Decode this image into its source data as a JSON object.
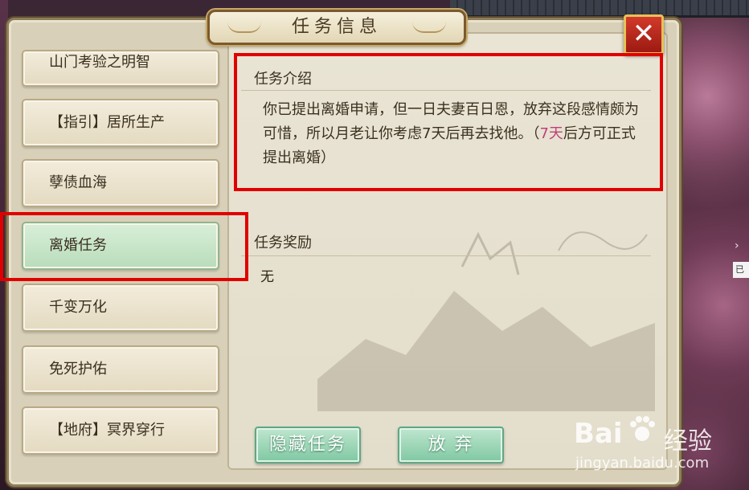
{
  "title": "任务信息",
  "close_label": "✕",
  "quests": [
    {
      "label": "山门考验之明智",
      "selected": false
    },
    {
      "label": "【指引】居所生产",
      "selected": false
    },
    {
      "label": "孽债血海",
      "selected": false
    },
    {
      "label": "离婚任务",
      "selected": true
    },
    {
      "label": "千变万化",
      "selected": false
    },
    {
      "label": "免死护佑",
      "selected": false
    },
    {
      "label": "【地府】冥界穿行",
      "selected": false
    }
  ],
  "intro": {
    "label": "任务介绍",
    "text_main": "你已提出离婚申请，但一日夫妻百日恩，放弃这段感情颇为可惜，所以月老让你考虑7天后再去找他。（",
    "text_highlight": "7天",
    "text_tail": "后方可正式提出离婚）"
  },
  "reward": {
    "label": "任务奖励",
    "value": "无"
  },
  "buttons": {
    "hide": "隐藏任务",
    "abandon": "放 弃"
  },
  "side": {
    "arrow": "›",
    "tag": "已"
  },
  "watermark": {
    "brand_a": "Bai",
    "brand_b": "经验",
    "url": "jingyan.baidu.com"
  },
  "colors": {
    "highlight_box": "#e00000",
    "selected_item": "#c8e6cb",
    "button_green": "#8fd0ad",
    "close_red": "#c0281c",
    "pink_text": "#c0407a"
  }
}
